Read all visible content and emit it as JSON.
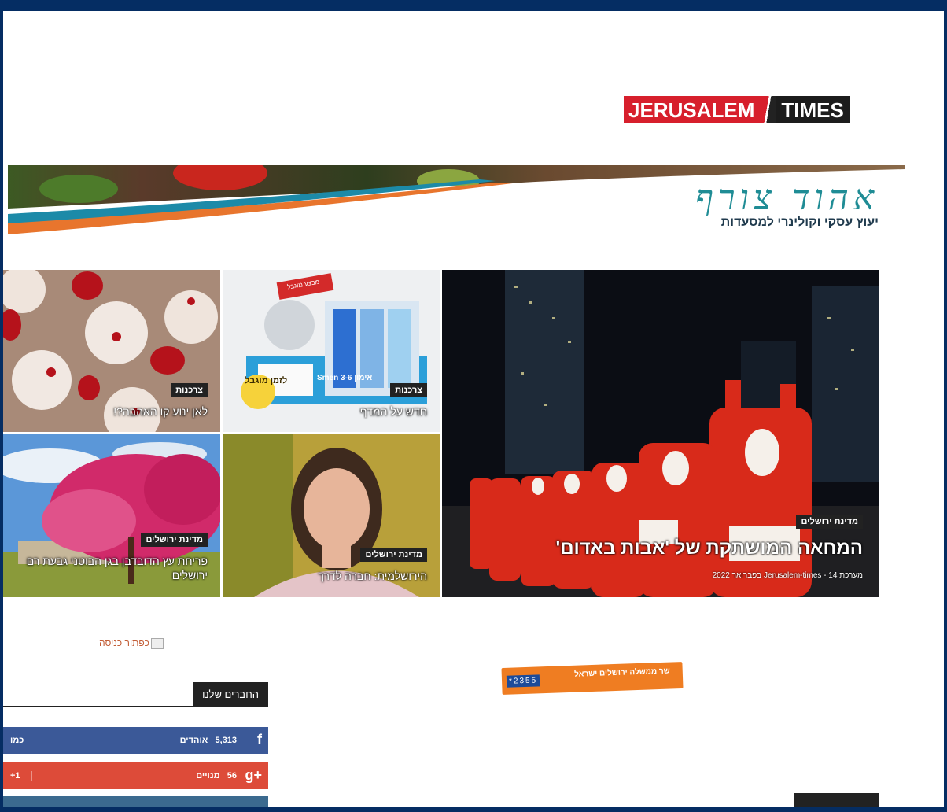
{
  "logo": {
    "part1": "JERUSALEM",
    "part2": "TIMES"
  },
  "banner": {
    "script": "אהוד צורף",
    "tagline": "יעוץ עסקי וקולינרי למסעדות"
  },
  "featured": {
    "category": "מדינת ירושלים",
    "title": "המחאה המושתקת של 'אבות באדום'",
    "author": "מערכת Jerusalem-times",
    "date": "14 בפברואר 2022"
  },
  "tiles": [
    {
      "category": "צרכנות",
      "title": "חדש על המדף"
    },
    {
      "category": "צרכנות",
      "title": "לאן ינוע קו האהבה?!"
    },
    {
      "category": "מדינת ירושלים",
      "title": "הירושלמית: חברה לדרך"
    },
    {
      "category": "מדינת ירושלים",
      "title": "פריחת עץ הדובדבן בגן הבוטני גבעת רם ירושלים"
    }
  ],
  "promo": {
    "blocked_badge": "מבצע מוגבל",
    "product": "אימון Smen 3-6",
    "limited": "לזמן מוגבל"
  },
  "broken_image_alt": "כפתור כניסה",
  "ad": {
    "number": "*2355",
    "text": "שר ממשלה ירושלים ישראל"
  },
  "friends": {
    "title": "החברים שלנו",
    "facebook": {
      "count": "5,313",
      "unit": "אוהדים",
      "action": "כמו"
    },
    "google": {
      "count": "56",
      "unit": "מנויים",
      "action": "+1"
    }
  },
  "colors": {
    "frame": "#052d63",
    "brand_red": "#d71f2c",
    "facebook": "#3b5998",
    "google": "#dd4b39",
    "banner_teal": "#1f8c95"
  }
}
